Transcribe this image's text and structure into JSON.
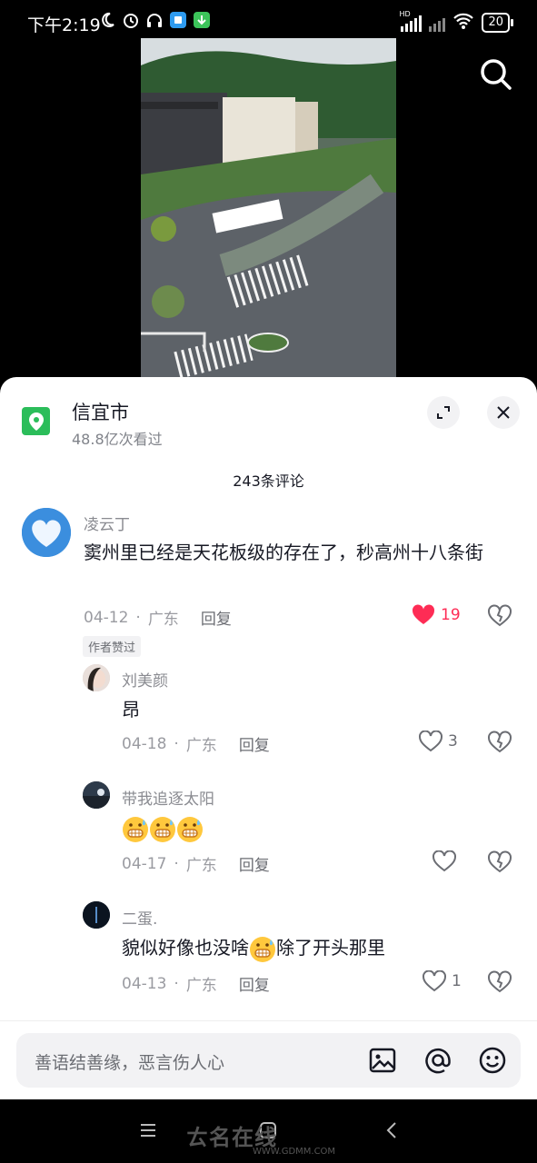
{
  "status_bar": {
    "time": "下午2:19",
    "network_label": "HD",
    "battery": "20"
  },
  "location": {
    "title": "信宜市",
    "views": "48.8亿次看过"
  },
  "comments_count": "243条评论",
  "comments": [
    {
      "user": "凌云丁",
      "text": "窦州里已经是天花板级的存在了，秒高州十八条街",
      "date": "04-12",
      "region": "广东",
      "reply": "回复",
      "likes": "19",
      "liked": true,
      "author_tag": "作者赞过"
    }
  ],
  "replies": [
    {
      "user": "刘美颜",
      "text": "昂",
      "date": "04-18",
      "region": "广东",
      "reply": "回复",
      "likes": "3"
    },
    {
      "user": "带我追逐太阳",
      "text": "",
      "date": "04-17",
      "region": "广东",
      "reply": "回复",
      "likes": ""
    },
    {
      "user": "二蛋.",
      "text_before": "貌似好像也没啥",
      "text_after": "除了开头那里",
      "date": "04-13",
      "region": "广东",
      "reply": "回复",
      "likes": "1"
    }
  ],
  "input": {
    "placeholder": "善语结善缘，恶言伤人心"
  },
  "watermark": {
    "brand": "ㄊ名在线",
    "url": "WWW.GDMM.COM"
  },
  "colors": {
    "like_red": "#fe2c55",
    "location_green": "#2bbd5a"
  }
}
